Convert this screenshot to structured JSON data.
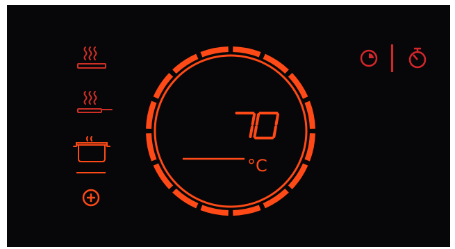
{
  "colors": {
    "panel_bg": "#070709",
    "mode_red": "#cf2f25",
    "accent_orange": "#ff4a17",
    "timer_red": "#d7262b"
  },
  "modes": [
    {
      "name": "griddle",
      "icon": "griddle-steam-icon"
    },
    {
      "name": "frying-pan",
      "icon": "frying-pan-steam-icon"
    },
    {
      "name": "pot",
      "icon": "pot-steam-icon",
      "selected": true
    }
  ],
  "add_icon": "plus-circle-icon",
  "display": {
    "temperature": "70",
    "unit": "°C",
    "ring_segments": 16
  },
  "timer_icons": [
    "cook-timer-icon",
    "stopwatch-icon"
  ]
}
